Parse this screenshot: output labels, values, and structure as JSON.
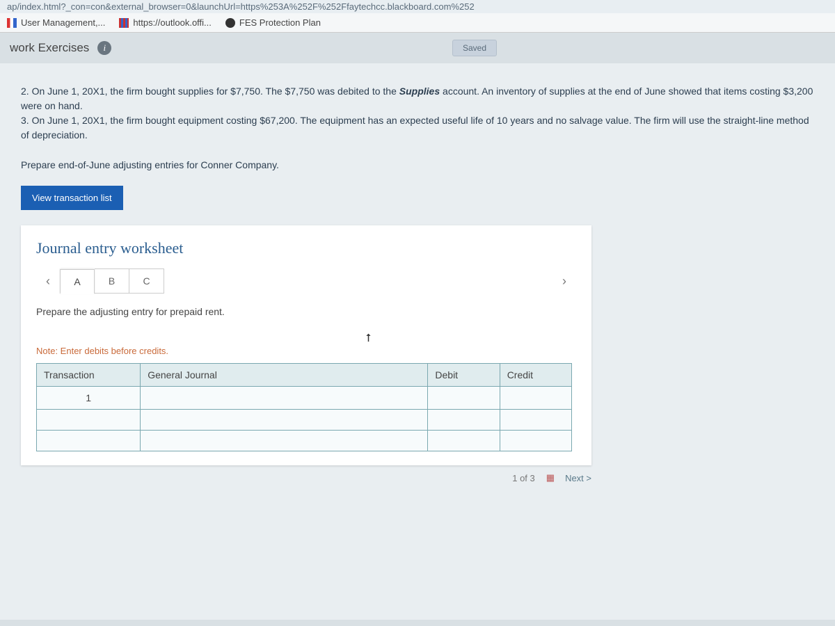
{
  "url_bar": "ap/index.html?_con=con&external_browser=0&launchUrl=https%253A%252F%252Ffaytechcc.blackboard.com%252",
  "bookmarks": {
    "b1": "User Management,...",
    "b2": "https://outlook.offi...",
    "b3": "FES Protection Plan"
  },
  "header": {
    "title": "work Exercises",
    "saved": "Saved"
  },
  "problem": {
    "line2a": "2. On June 1, 20X1, the firm bought supplies for $7,750. The $7,750 was debited to the ",
    "line2bold": "Supplies",
    "line2b": " account. An inventory of supplies at the end of June showed that items costing $3,200 were on hand.",
    "line3": "3. On June 1, 20X1, the firm bought equipment costing $67,200. The equipment has an expected useful life of 10 years and no salvage value. The firm will use the straight-line method of depreciation."
  },
  "instruction": "Prepare end-of-June adjusting entries for Conner Company.",
  "view_btn": "View transaction list",
  "worksheet": {
    "title": "Journal entry worksheet",
    "tabs": {
      "a": "A",
      "b": "B",
      "c": "C"
    },
    "entry_desc": "Prepare the adjusting entry for prepaid rent.",
    "note": "Note: Enter debits before credits.",
    "cols": {
      "transaction": "Transaction",
      "gj": "General Journal",
      "debit": "Debit",
      "credit": "Credit"
    },
    "row1_trans": "1"
  },
  "footer": {
    "counter": "1 of 3",
    "next": "Next  >"
  }
}
